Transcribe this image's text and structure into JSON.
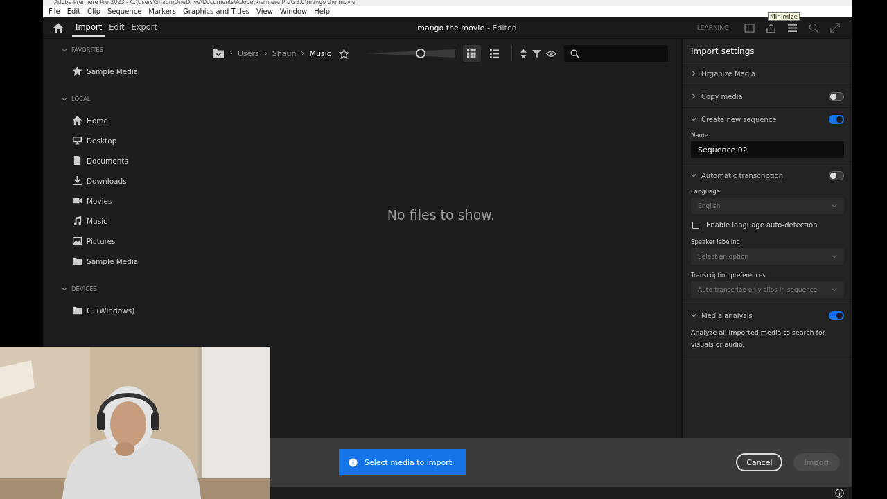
{
  "window": {
    "title": "Adobe Premiere Pro 2023 - C:\\Users\\Shaun\\OneDrive\\Documents\\Adobe\\Premiere Pro\\23.0\\mango the movie"
  },
  "menu": [
    "File",
    "Edit",
    "Clip",
    "Sequence",
    "Markers",
    "Graphics and Titles",
    "View",
    "Window",
    "Help"
  ],
  "header": {
    "tabs": [
      {
        "label": "Import",
        "selected": true
      },
      {
        "label": "Edit",
        "selected": false
      },
      {
        "label": "Export",
        "selected": false
      }
    ],
    "project": "mango the movie",
    "status": "- Edited",
    "learning": "LEARNING"
  },
  "tooltip": "Minimize",
  "sidebar": {
    "sections": [
      {
        "title": "FAVORITES",
        "expanded": true,
        "items": [
          {
            "label": "Sample Media",
            "kind": "star"
          }
        ]
      },
      {
        "title": "LOCAL",
        "expanded": true,
        "items": [
          {
            "label": "Home",
            "kind": "home"
          },
          {
            "label": "Desktop",
            "kind": "desktop"
          },
          {
            "label": "Documents",
            "kind": "document"
          },
          {
            "label": "Downloads",
            "kind": "download"
          },
          {
            "label": "Movies",
            "kind": "movie"
          },
          {
            "label": "Music",
            "kind": "music"
          },
          {
            "label": "Pictures",
            "kind": "picture"
          },
          {
            "label": "Sample Media",
            "kind": "folder"
          }
        ]
      },
      {
        "title": "DEVICES",
        "expanded": true,
        "items": [
          {
            "label": "C: (Windows)",
            "kind": "folder"
          }
        ]
      }
    ]
  },
  "browser": {
    "breadcrumb": [
      "Users",
      "Shaun",
      "Music"
    ],
    "zoom": {
      "level": 0.62
    },
    "views": [
      {
        "kind": "grid",
        "selected": true
      },
      {
        "kind": "list",
        "selected": false
      }
    ],
    "empty": "No files to show."
  },
  "settings": {
    "title": "Import settings",
    "sections": [
      {
        "title": "Organize Media",
        "expanded": false
      },
      {
        "title": "Copy media",
        "expanded": false,
        "on": false
      },
      {
        "title": "Create new sequence",
        "expanded": true,
        "on": true,
        "fields": [
          {
            "kind": "text",
            "label": "Name",
            "value": "Sequence 02"
          }
        ]
      },
      {
        "title": "Automatic transcription",
        "expanded": true,
        "on": false,
        "fields": [
          {
            "kind": "select",
            "label": "Language",
            "value": "English",
            "disabled": true
          },
          {
            "kind": "checkbox",
            "text": "Enable language auto-detection",
            "checked": false
          },
          {
            "kind": "select",
            "label": "Speaker labeling",
            "placeholder": "Select an option",
            "disabled": true
          },
          {
            "kind": "select",
            "label": "Transcription preferences",
            "value": "Auto-transcribe only clips in sequence",
            "disabled": true
          }
        ]
      },
      {
        "title": "Media analysis",
        "expanded": true,
        "on": true,
        "description": "Analyze all imported media to search for visuals or audio."
      }
    ]
  },
  "footer": {
    "message": "Select media to import",
    "buttons": [
      {
        "label": "Cancel",
        "disabled": false
      },
      {
        "label": "Import",
        "disabled": true
      }
    ]
  }
}
